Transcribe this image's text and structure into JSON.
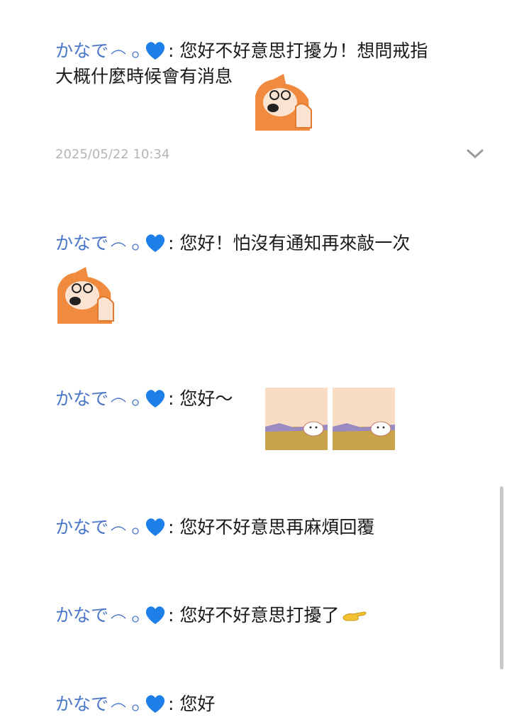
{
  "messages": [
    {
      "name": "かなで",
      "text": "您好不好意思打擾ㄌ！想問戒指",
      "text2": "大概什麼時候會有消息"
    },
    {
      "name": "かなで",
      "text": "您好！怕沒有通知再來敲一次"
    },
    {
      "name": "かなで",
      "text": "您好～"
    },
    {
      "name": "かなで",
      "text": "您好不好意思再麻煩回覆"
    },
    {
      "name": "かなで",
      "text": "您好不好意思打擾了"
    },
    {
      "name": "かなで",
      "text": "您好"
    }
  ],
  "timestamp": "2025/05/22 10:34",
  "colors": {
    "name": "#4a76c8",
    "heart": "#1e7fe8",
    "fox": "#f08a3e"
  },
  "icons": [
    "blue-heart-icon",
    "fox-sticker",
    "cat-sticker",
    "chevron-down-icon",
    "pointing-hand-icon"
  ]
}
